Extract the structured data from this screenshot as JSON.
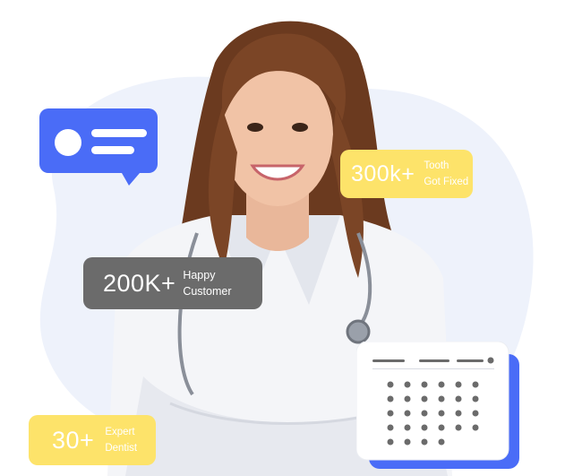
{
  "stats": {
    "tooth": {
      "number": "300k+",
      "label_line1": "Tooth",
      "label_line2": "Got Fixed"
    },
    "customer": {
      "number": "200K+",
      "label_line1": "Happy",
      "label_line2": "Customer"
    },
    "dentist": {
      "number": "30+",
      "label_line1": "Expert",
      "label_line2": "Dentist"
    }
  },
  "icons": {
    "chat": "chat-bubble-icon",
    "calendar": "calendar-icon"
  },
  "colors": {
    "accent_blue": "#4a6cf7",
    "accent_yellow": "#fde36a",
    "card_gray": "#6b6b6b",
    "blob": "#eef2fb",
    "calendar_dots": "#6b6b6b"
  }
}
